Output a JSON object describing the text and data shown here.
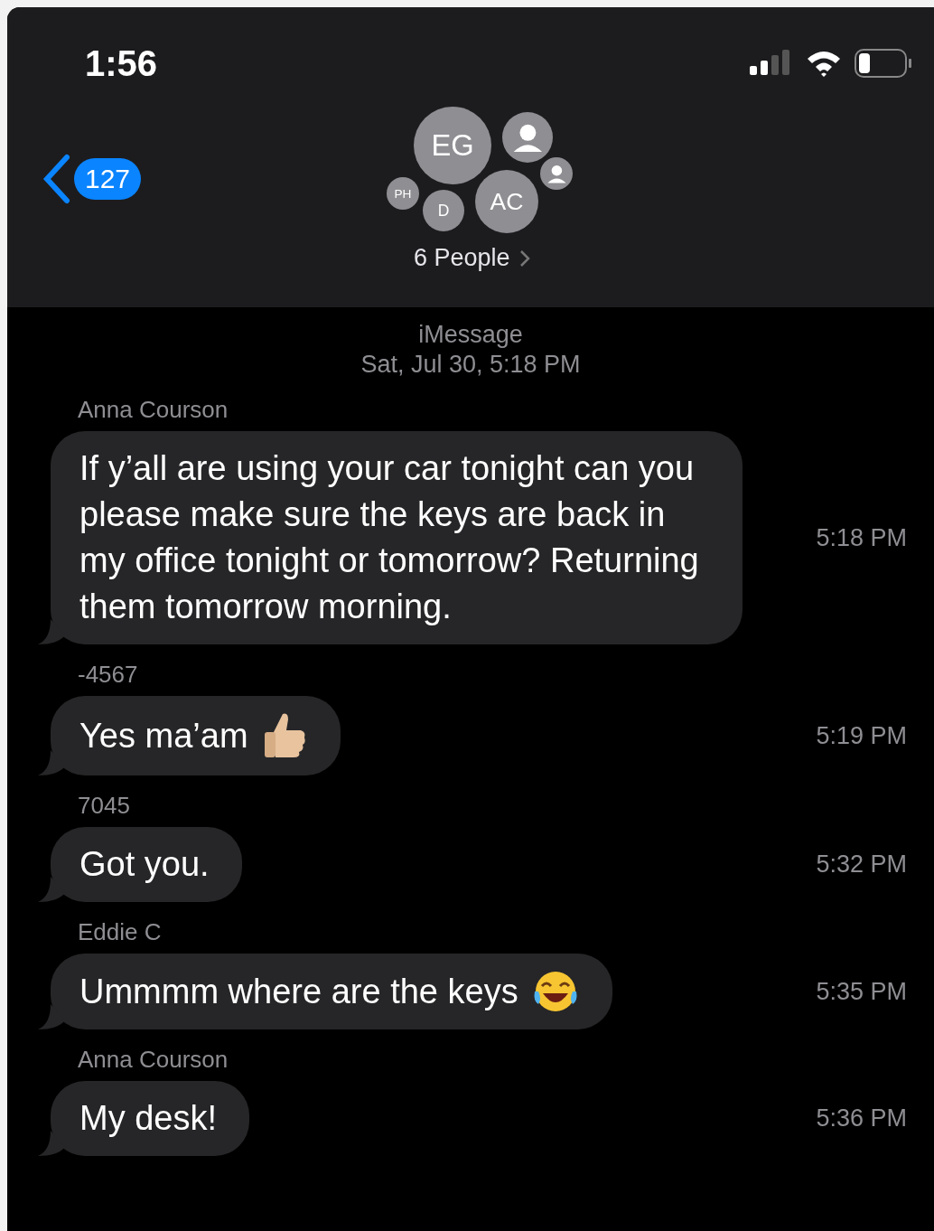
{
  "status_bar": {
    "time": "1:56"
  },
  "header": {
    "back_count": "127",
    "avatars": [
      {
        "kind": "initials",
        "label": "EG"
      },
      {
        "kind": "silhouette"
      },
      {
        "kind": "silhouette"
      },
      {
        "kind": "initials",
        "label": "PH"
      },
      {
        "kind": "initials",
        "label": "D"
      },
      {
        "kind": "initials",
        "label": "AC"
      }
    ],
    "title": "6 People"
  },
  "service": "iMessage",
  "date": "Sat, Jul 30, 5:18 PM",
  "messages": [
    {
      "kind": "plain",
      "sender": "Anna Courson",
      "text": "If y’all are using your car tonight can you please make sure the keys are back in my office tonight or tomorrow? Returning them tomorrow morning.",
      "time": "5:18 PM"
    },
    {
      "kind": "thumbsup",
      "sender": "-4567",
      "text": "Yes ma’am",
      "time": "5:19 PM"
    },
    {
      "kind": "plain",
      "sender": "7045",
      "text": "Got you.",
      "time": "5:32 PM"
    },
    {
      "kind": "laughing",
      "sender": "Eddie C",
      "text": "Ummmm where are the keys",
      "time": "5:35 PM"
    },
    {
      "kind": "plain",
      "sender": "Anna Courson",
      "text": "My desk!",
      "time": "5:36 PM"
    }
  ]
}
